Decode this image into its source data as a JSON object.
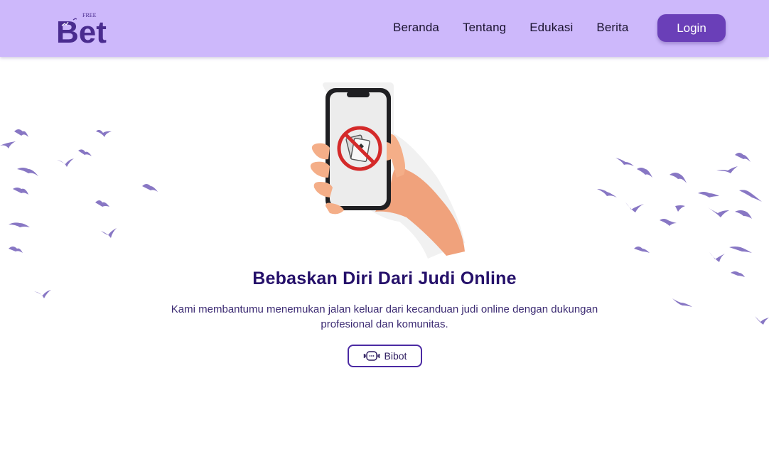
{
  "brand": {
    "logo_text": "Bet",
    "logo_tag": "FREE"
  },
  "nav": {
    "items": [
      {
        "label": "Beranda"
      },
      {
        "label": "Tentang"
      },
      {
        "label": "Edukasi"
      },
      {
        "label": "Berita"
      }
    ],
    "login_label": "Login"
  },
  "hero": {
    "title": "Bebaskan Diri Dari Judi Online",
    "subtitle": "Kami membantumu menemukan jalan keluar dari kecanduan judi online dengan dukungan profesional dan komunitas.",
    "cta_label": "Bibot",
    "cta_icon": "robot-icon"
  },
  "colors": {
    "navbar_bg": "#cdb8fb",
    "accent": "#6a3fb8",
    "title": "#25106a",
    "bird": "#8877c4"
  }
}
